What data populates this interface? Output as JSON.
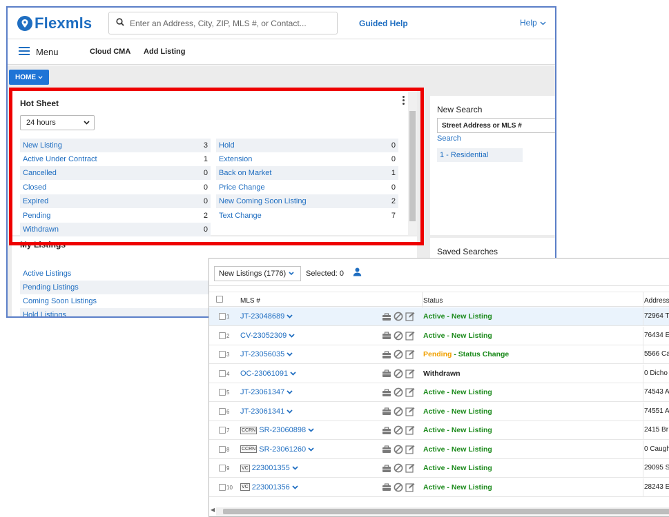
{
  "app": {
    "logo_text": "Flexmls",
    "search_placeholder": "Enter an Address, City, ZIP, MLS #, or Contact...",
    "guided_help": "Guided Help",
    "help": "Help"
  },
  "menubar": {
    "menu_label": "Menu",
    "links": [
      "Cloud CMA",
      "Add Listing"
    ]
  },
  "home_button": "HOME",
  "hotsheet": {
    "title": "Hot Sheet",
    "period": "24 hours",
    "left": [
      {
        "label": "New Listing",
        "count": "3"
      },
      {
        "label": "Active Under Contract",
        "count": "1"
      },
      {
        "label": "Cancelled",
        "count": "0"
      },
      {
        "label": "Closed",
        "count": "0"
      },
      {
        "label": "Expired",
        "count": "0"
      },
      {
        "label": "Pending",
        "count": "2"
      },
      {
        "label": "Withdrawn",
        "count": "0"
      }
    ],
    "right": [
      {
        "label": "Hold",
        "count": "0"
      },
      {
        "label": "Extension",
        "count": "0"
      },
      {
        "label": "Back on Market",
        "count": "1"
      },
      {
        "label": "Price Change",
        "count": "0"
      },
      {
        "label": "New Coming Soon Listing",
        "count": "2"
      },
      {
        "label": "Text Change",
        "count": "7"
      }
    ]
  },
  "my_listings": {
    "title": "My Listings",
    "items": [
      "Active Listings",
      "Pending Listings",
      "Coming Soon Listings",
      "Hold Listings"
    ]
  },
  "new_search": {
    "title": "New Search",
    "input_placeholder": "Street Address or MLS #",
    "search_link": "Search",
    "result": "1 - Residential"
  },
  "saved_searches": {
    "title": "Saved Searches"
  },
  "listings": {
    "view_select": "New Listings (1776)",
    "selected_text": "Selected: 0",
    "columns": {
      "mls": "MLS #",
      "status": "Status",
      "address": "Address"
    },
    "rows": [
      {
        "num": "1",
        "badge": "",
        "mls": "JT-23048689",
        "status_main": "Active",
        "status_sub": " - New Listing",
        "status_kind": "active",
        "address": "72964 T"
      },
      {
        "num": "2",
        "badge": "",
        "mls": "CV-23052309",
        "status_main": "Active",
        "status_sub": " - New Listing",
        "status_kind": "active",
        "address": "76434 E"
      },
      {
        "num": "3",
        "badge": "",
        "mls": "JT-23056035",
        "status_main": "Pending",
        "status_sub": " - Status Change",
        "status_kind": "pending",
        "address": "5566 Ca"
      },
      {
        "num": "4",
        "badge": "",
        "mls": "OC-23061091",
        "status_main": "Withdrawn",
        "status_sub": "",
        "status_kind": "withdrawn",
        "address": "0 Dicho"
      },
      {
        "num": "5",
        "badge": "",
        "mls": "JT-23061347",
        "status_main": "Active",
        "status_sub": " - New Listing",
        "status_kind": "active",
        "address": "74543 A"
      },
      {
        "num": "6",
        "badge": "",
        "mls": "JT-23061341",
        "status_main": "Active",
        "status_sub": " - New Listing",
        "status_kind": "active",
        "address": "74551 A"
      },
      {
        "num": "7",
        "badge": "CCRN",
        "mls": "SR-23060898",
        "status_main": "Active",
        "status_sub": " - New Listing",
        "status_kind": "active",
        "address": "2415 Br"
      },
      {
        "num": "8",
        "badge": "CCRN",
        "mls": "SR-23061260",
        "status_main": "Active",
        "status_sub": " - New Listing",
        "status_kind": "active",
        "address": "0 Caugh"
      },
      {
        "num": "9",
        "badge": "VC",
        "mls": "223001355",
        "status_main": "Active",
        "status_sub": " - New Listing",
        "status_kind": "active",
        "address": "29095 S"
      },
      {
        "num": "10",
        "badge": "VC",
        "mls": "223001356",
        "status_main": "Active",
        "status_sub": " - New Listing",
        "status_kind": "active",
        "address": "28243 E"
      }
    ]
  },
  "colors": {
    "brand_blue": "#1f6ec1",
    "highlight_red": "#ee0000",
    "active_green": "#1b8a1b",
    "pending_orange": "#f0a000"
  }
}
